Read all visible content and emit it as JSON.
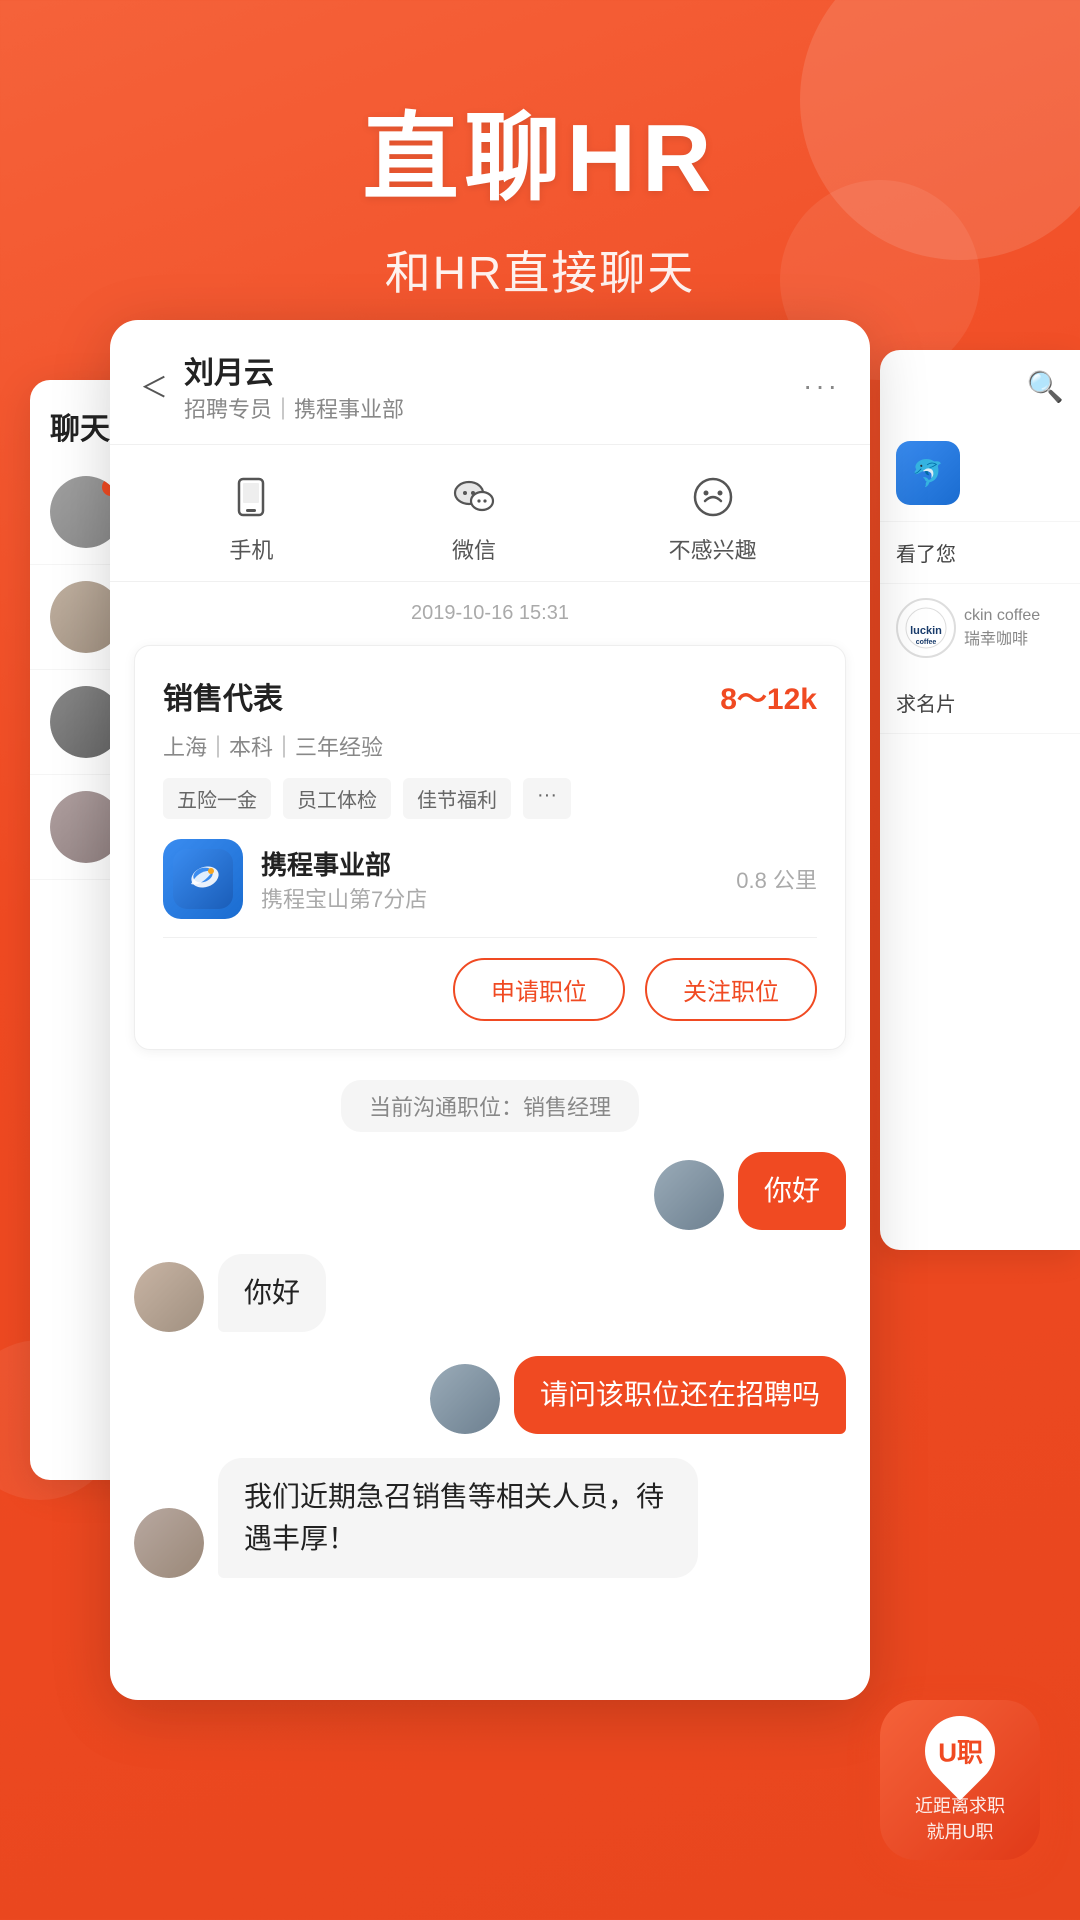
{
  "hero": {
    "title": "直聊HR",
    "subtitle": "和HR直接聊天"
  },
  "chat_header": {
    "back": "＜",
    "name": "刘月云",
    "role": "招聘专员｜携程事业部",
    "dots": "···"
  },
  "action_tabs": [
    {
      "id": "phone",
      "label": "手机",
      "icon": "📱"
    },
    {
      "id": "wechat",
      "label": "微信",
      "icon": "💬"
    },
    {
      "id": "dislike",
      "label": "不感兴趣",
      "icon": "😣"
    }
  ],
  "timestamp": "2019-10-16 15:31",
  "job_card": {
    "title": "销售代表",
    "salary": "8～12k",
    "details": "上海｜本科｜三年经验",
    "tags": [
      "五险一金",
      "员工体检",
      "佳节福利",
      "···"
    ],
    "company_name": "携程事业部",
    "company_branch": "携程宝山第7分店",
    "company_distance": "0.8 公里",
    "btn_apply": "申请职位",
    "btn_follow": "关注职位"
  },
  "current_position_notice": "当前沟通职位：销售经理",
  "messages": [
    {
      "type": "outgoing",
      "text": "你好",
      "avatar_class": "av-male1"
    },
    {
      "type": "incoming",
      "text": "你好",
      "avatar_class": "av-female1"
    },
    {
      "type": "outgoing",
      "text": "请问该职位还在招聘吗",
      "avatar_class": "av-male1"
    },
    {
      "type": "incoming",
      "text": "我们近期急召销售等相关人员，待遇丰厚！",
      "avatar_class": "av-female2"
    }
  ],
  "chat_list": {
    "title": "聊天",
    "avatars": [
      "av1",
      "av2",
      "av3",
      "av4"
    ]
  },
  "right_card": {
    "looked_text": "看了您",
    "card_text": "求名片"
  },
  "uzhi": {
    "icon": "U职",
    "tagline1": "近距离求职",
    "tagline2": "就用U职"
  }
}
